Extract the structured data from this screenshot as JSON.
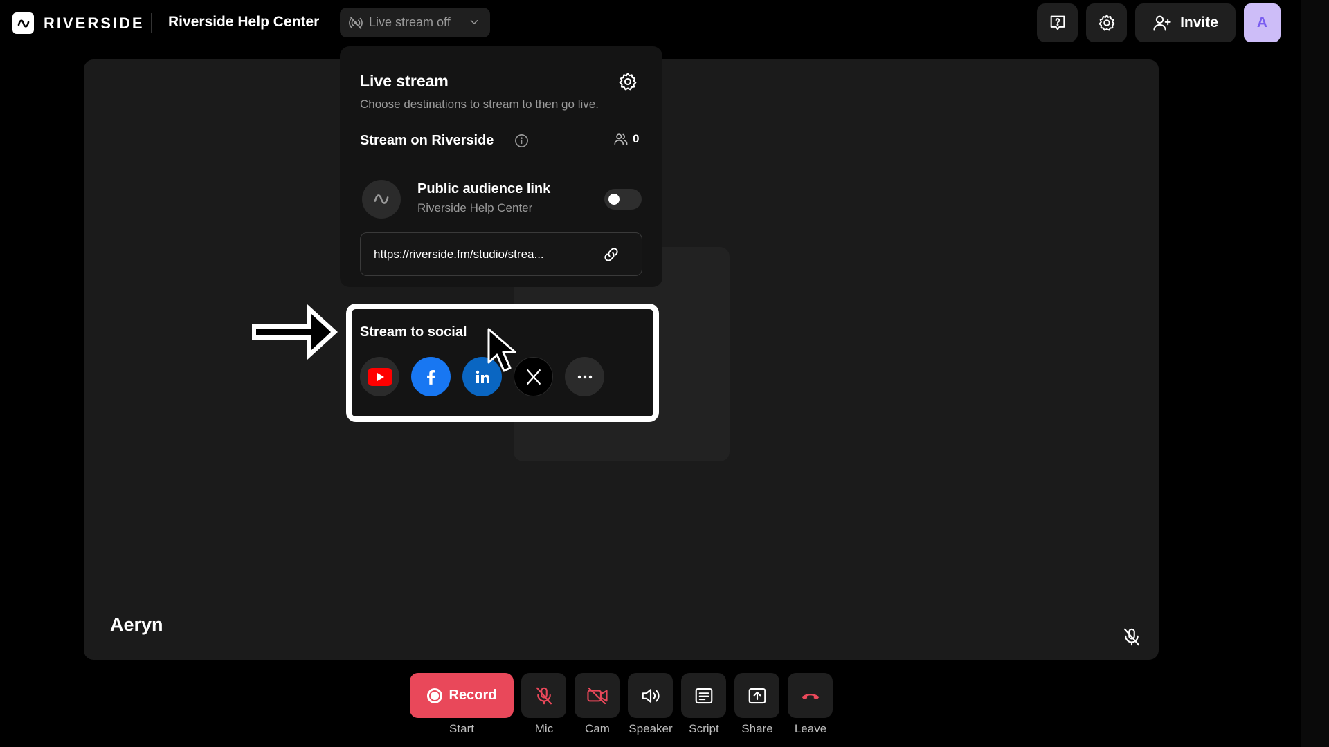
{
  "header": {
    "brand": "RIVERSIDE",
    "studio_name": "Riverside Help Center",
    "live_status": "Live stream off",
    "invite_label": "Invite",
    "avatar_initial": "A"
  },
  "live_panel": {
    "title": "Live stream",
    "subtitle": "Choose destinations to stream to then go live.",
    "stream_on_riverside": "Stream on Riverside",
    "viewer_count": "0",
    "audience_title": "Public audience link",
    "audience_subtitle": "Riverside Help Center",
    "public_link_enabled": false,
    "url": "https://riverside.fm/studio/strea...",
    "social_title": "Stream to social",
    "socials": [
      "youtube-icon",
      "facebook-icon",
      "linkedin-icon",
      "x-icon",
      "more-icon"
    ]
  },
  "stage": {
    "participant_name": "Aeryn"
  },
  "controls": {
    "record_label": "Record",
    "start_label": "Start",
    "mic_label": "Mic",
    "cam_label": "Cam",
    "speaker_label": "Speaker",
    "script_label": "Script",
    "share_label": "Share",
    "leave_label": "Leave"
  },
  "colors": {
    "record": "#e9485a",
    "leave": "#e9485a",
    "facebook": "#1877f2",
    "linkedin": "#0a66c2",
    "youtube": "#ff0000",
    "avatar_bg": "#cdbdf8"
  }
}
